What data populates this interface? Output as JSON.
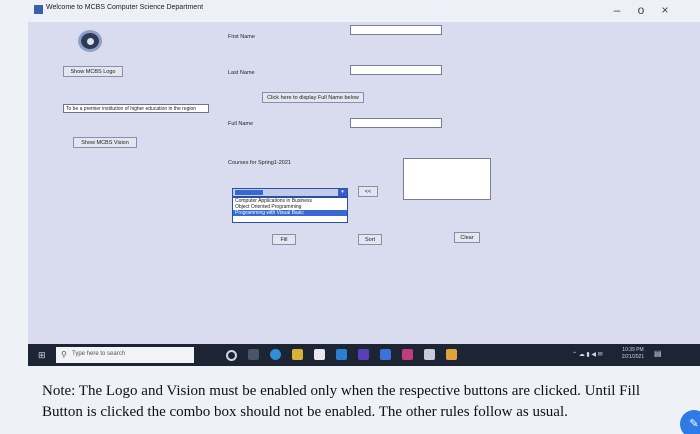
{
  "window": {
    "title": "Welcome to MCBS Computer Science Department",
    "minimize_glyph": "–",
    "maximize_glyph": "o",
    "close_glyph": "×"
  },
  "form": {
    "show_logo_button": "Show MCBS Logo",
    "vision_text": "To be a premier institution of higher education in the region",
    "show_vision_button": "Show MCBS Vision",
    "first_name_label": "First Name",
    "last_name_label": "Last Name",
    "display_button": "Click here to display Full Name below",
    "full_name_label": "Full Name",
    "courses_label": "Courses for Spring1-2021",
    "combo": {
      "arrow_glyph": "▾",
      "options": [
        "Computer Applications in Business",
        "Object Oriented Programming",
        "Programming with Visual Basic"
      ]
    },
    "small_button": "<<",
    "fill_button": "Fill",
    "sort_button": "Sort",
    "clear_button": "Clear"
  },
  "taskbar": {
    "search_placeholder": "Type here to search",
    "clock_time": "10:39 PM",
    "clock_date": "2/21/2021"
  },
  "note": "Note: The Logo and Vision must be enabled only when the respective buttons are clicked. Until Fill Button is clicked the combo box should not be enabled. The other rules follow as usual.",
  "colors": {
    "form_background": "#d9dcef",
    "taskbar": "#1d2433",
    "selection": "#3867d6"
  }
}
